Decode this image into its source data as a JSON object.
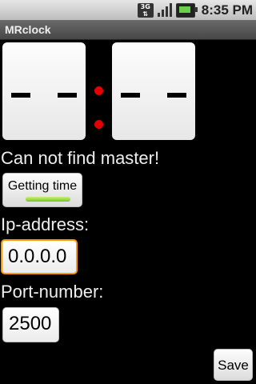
{
  "status_bar": {
    "network_label": "3G",
    "time": "8:35 PM",
    "icons": [
      "network-3g-icon",
      "signal-strength-icon",
      "battery-charging-icon"
    ]
  },
  "app": {
    "title": "MRclock"
  },
  "clock": {
    "hours_display": "— —",
    "minutes_display": "— —",
    "colon_color": "#e40000"
  },
  "status_message": "Can not find master!",
  "getting_time_button": {
    "label": "Getting time",
    "indicator_color": "#7bc320"
  },
  "ip_field": {
    "label": "Ip-address:",
    "value": "0.0.0.0",
    "focus_color": "#ff9600"
  },
  "port_field": {
    "label": "Port-number:",
    "value": "2500"
  },
  "save_button": {
    "label": "Save"
  }
}
